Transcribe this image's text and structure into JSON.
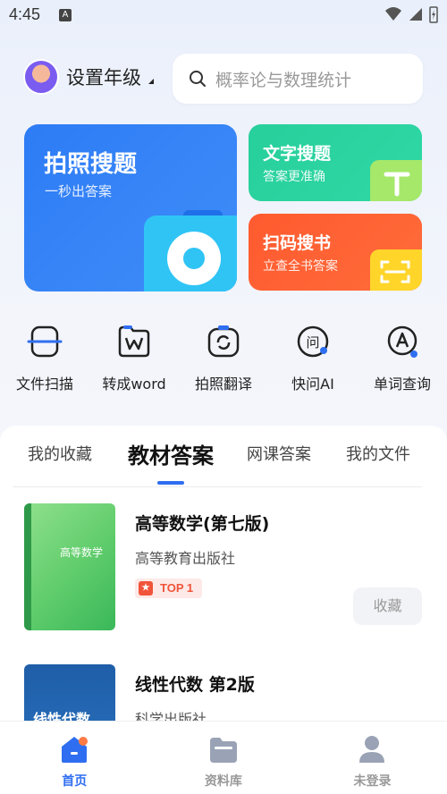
{
  "status_bar": {
    "time": "4:45",
    "indicator": "A"
  },
  "header": {
    "grade_label": "设置年级",
    "search_placeholder": "概率论与数理统计"
  },
  "feature_cards": {
    "photo_search": {
      "title": "拍照搜题",
      "subtitle": "一秒出答案",
      "icon": "camera-search-icon"
    },
    "text_search": {
      "title": "文字搜题",
      "subtitle": "答案更准确",
      "icon": "text-t-icon"
    },
    "code_scan": {
      "title": "扫码搜书",
      "subtitle": "立查全书答案",
      "icon": "scan-icon"
    }
  },
  "tools": [
    {
      "label": "文件扫描",
      "icon": "file-scan-icon"
    },
    {
      "label": "转成word",
      "icon": "word-convert-icon"
    },
    {
      "label": "拍照翻译",
      "icon": "photo-translate-icon"
    },
    {
      "label": "快问AI",
      "icon": "ask-ai-icon"
    },
    {
      "label": "单词查询",
      "icon": "word-lookup-icon"
    }
  ],
  "tabs": [
    "我的收藏",
    "教材答案",
    "网课答案",
    "我的文件"
  ],
  "active_tab": "教材答案",
  "books": [
    {
      "title": "高等数学(第七版)",
      "publisher": "高等教育出版社",
      "badge": "TOP 1",
      "action": "收藏",
      "cover_text": "高等数学"
    },
    {
      "title": "线性代数 第2版",
      "publisher": "科学出版社",
      "cover_text": "线性代数"
    }
  ],
  "bottom_nav": [
    {
      "label": "首页",
      "icon": "home-icon",
      "active": true
    },
    {
      "label": "资料库",
      "icon": "folder-icon",
      "active": false
    },
    {
      "label": "未登录",
      "icon": "user-icon",
      "active": false
    }
  ],
  "colors": {
    "accent": "#2f6ef0",
    "photo_card": "#2e7cf5",
    "text_card": "#27cf9b",
    "scan_card": "#ff5a2f",
    "badge": "#f0543a"
  }
}
